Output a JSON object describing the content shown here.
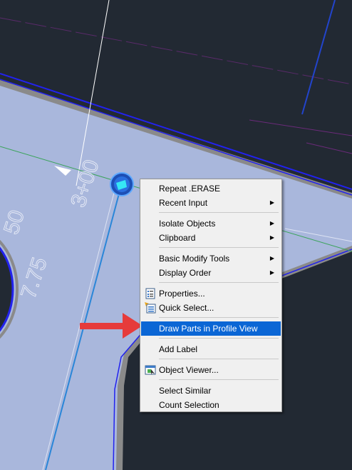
{
  "drawing": {
    "station_label": "3+00",
    "left_label_top": "50",
    "left_label_bottom": "7.75"
  },
  "context_menu": {
    "items": [
      {
        "label": "Repeat .ERASE",
        "submenu": false
      },
      {
        "label": "Recent Input",
        "submenu": true
      },
      {
        "label": "Isolate Objects",
        "submenu": true
      },
      {
        "label": "Clipboard",
        "submenu": true
      },
      {
        "label": "Basic Modify Tools",
        "submenu": true
      },
      {
        "label": "Display Order",
        "submenu": true
      },
      {
        "label": "Properties...",
        "submenu": false,
        "icon": "properties-icon"
      },
      {
        "label": "Quick Select...",
        "submenu": false,
        "icon": "quick-select-icon"
      },
      {
        "label": "Draw Parts in Profile View",
        "submenu": false,
        "highlighted": true
      },
      {
        "label": "Add Label",
        "submenu": false
      },
      {
        "label": "Object Viewer...",
        "submenu": false,
        "icon": "object-viewer-icon"
      },
      {
        "label": "Select Similar",
        "submenu": false
      },
      {
        "label": "Count Selection",
        "submenu": false
      }
    ],
    "submenu_arrow": "▶"
  },
  "colors": {
    "background": "#222933",
    "pipe_fill": "#a9b7dc",
    "pipe_outline": "#2222ee",
    "highlight": "#0b66d5",
    "callout_arrow": "#e63b3b"
  }
}
